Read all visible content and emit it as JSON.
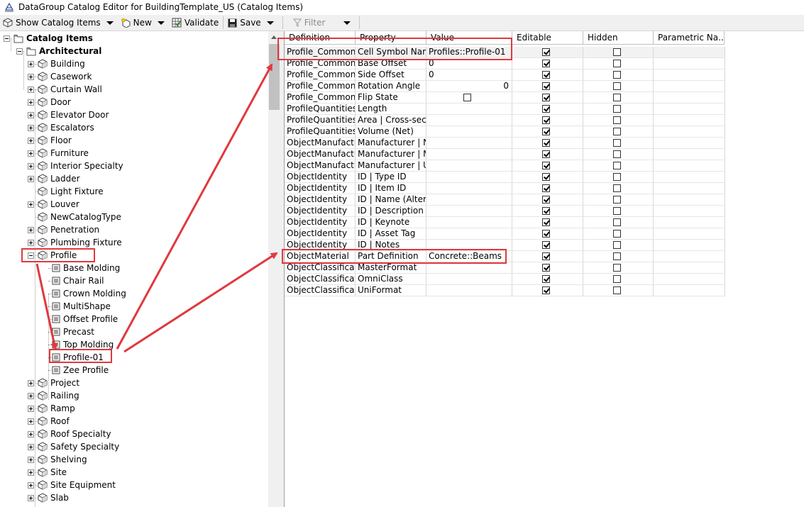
{
  "window": {
    "title": "DataGroup Catalog Editor for BuildingTemplate_US (Catalog Items)"
  },
  "toolbar": {
    "show_catalog_label": "Show Catalog Items",
    "new_label": "New",
    "validate_label": "Validate",
    "save_label": "Save",
    "filter_placeholder": "Filter"
  },
  "tree": {
    "nodes": [
      {
        "label": "Catalog Items",
        "level": 0,
        "expander": "minus",
        "icon": "folder-icon",
        "bold": true
      },
      {
        "label": "Architectural",
        "level": 1,
        "expander": "minus",
        "icon": "folder-icon",
        "bold": true
      },
      {
        "label": "Building",
        "level": 2,
        "expander": "plus",
        "icon": "cube-icon"
      },
      {
        "label": "Casework",
        "level": 2,
        "expander": "plus",
        "icon": "cube-icon"
      },
      {
        "label": "Curtain Wall",
        "level": 2,
        "expander": "plus",
        "icon": "cube-icon"
      },
      {
        "label": "Door",
        "level": 2,
        "expander": "plus",
        "icon": "cube-icon"
      },
      {
        "label": "Elevator Door",
        "level": 2,
        "expander": "plus",
        "icon": "cube-icon"
      },
      {
        "label": "Escalators",
        "level": 2,
        "expander": "plus",
        "icon": "cube-icon"
      },
      {
        "label": "Floor",
        "level": 2,
        "expander": "plus",
        "icon": "cube-icon"
      },
      {
        "label": "Furniture",
        "level": 2,
        "expander": "plus",
        "icon": "cube-icon"
      },
      {
        "label": "Interior Specialty",
        "level": 2,
        "expander": "plus",
        "icon": "cube-icon"
      },
      {
        "label": "Ladder",
        "level": 2,
        "expander": "plus",
        "icon": "cube-icon"
      },
      {
        "label": "Light Fixture",
        "level": 2,
        "expander": "none",
        "icon": "cube-icon"
      },
      {
        "label": "Louver",
        "level": 2,
        "expander": "plus",
        "icon": "cube-icon"
      },
      {
        "label": "NewCatalogType",
        "level": 2,
        "expander": "none",
        "icon": "cube-icon"
      },
      {
        "label": "Penetration",
        "level": 2,
        "expander": "plus",
        "icon": "cube-icon"
      },
      {
        "label": "Plumbing Fixture",
        "level": 2,
        "expander": "plus",
        "icon": "cube-icon"
      },
      {
        "label": "Profile",
        "level": 2,
        "expander": "minus",
        "icon": "cube-icon"
      },
      {
        "label": "Base Molding",
        "level": 3,
        "expander": "none",
        "icon": "item-icon"
      },
      {
        "label": "Chair Rail",
        "level": 3,
        "expander": "none",
        "icon": "item-icon"
      },
      {
        "label": "Crown Molding",
        "level": 3,
        "expander": "none",
        "icon": "item-icon"
      },
      {
        "label": "MultiShape",
        "level": 3,
        "expander": "none",
        "icon": "item-icon"
      },
      {
        "label": "Offset Profile",
        "level": 3,
        "expander": "none",
        "icon": "item-icon"
      },
      {
        "label": "Precast",
        "level": 3,
        "expander": "none",
        "icon": "item-icon"
      },
      {
        "label": "Top Molding",
        "level": 3,
        "expander": "none",
        "icon": "item-icon"
      },
      {
        "label": "Profile-01",
        "level": 3,
        "expander": "none",
        "icon": "item-icon"
      },
      {
        "label": "Zee Profile",
        "level": 3,
        "expander": "none",
        "icon": "item-icon"
      },
      {
        "label": "Project",
        "level": 2,
        "expander": "plus",
        "icon": "cube-icon"
      },
      {
        "label": "Railing",
        "level": 2,
        "expander": "plus",
        "icon": "cube-icon"
      },
      {
        "label": "Ramp",
        "level": 2,
        "expander": "plus",
        "icon": "cube-icon"
      },
      {
        "label": "Roof",
        "level": 2,
        "expander": "plus",
        "icon": "cube-icon"
      },
      {
        "label": "Roof Specialty",
        "level": 2,
        "expander": "plus",
        "icon": "cube-icon"
      },
      {
        "label": "Safety Specialty",
        "level": 2,
        "expander": "plus",
        "icon": "cube-icon"
      },
      {
        "label": "Shelving",
        "level": 2,
        "expander": "plus",
        "icon": "cube-icon"
      },
      {
        "label": "Site",
        "level": 2,
        "expander": "plus",
        "icon": "cube-icon"
      },
      {
        "label": "Site Equipment",
        "level": 2,
        "expander": "plus",
        "icon": "cube-icon"
      },
      {
        "label": "Slab",
        "level": 2,
        "expander": "plus",
        "icon": "cube-icon"
      }
    ]
  },
  "grid": {
    "columns": [
      "Definition",
      "Property",
      "Value",
      "Editable",
      "Hidden",
      "Parametric Na..."
    ],
    "rows": [
      {
        "definition": "Profile_Common",
        "property": "Cell Symbol Name",
        "value": "Profiles::Profile-01",
        "value_kind": "text",
        "editable": true,
        "hidden": false
      },
      {
        "definition": "Profile_Common",
        "property": "Base Offset",
        "value": "0",
        "value_kind": "text",
        "editable": true,
        "hidden": false
      },
      {
        "definition": "Profile_Common",
        "property": "Side Offset",
        "value": "0",
        "value_kind": "text",
        "editable": true,
        "hidden": false
      },
      {
        "definition": "Profile_Common",
        "property": "Rotation Angle",
        "value": "0",
        "value_kind": "right",
        "editable": true,
        "hidden": false
      },
      {
        "definition": "Profile_Common",
        "property": "Flip State",
        "value": "",
        "value_kind": "checkbox",
        "editable": true,
        "hidden": false
      },
      {
        "definition": "ProfileQuantities",
        "property": "Length",
        "value": "",
        "value_kind": "text",
        "editable": true,
        "hidden": false
      },
      {
        "definition": "ProfileQuantities",
        "property": "Area | Cross-section",
        "value": "",
        "value_kind": "text",
        "editable": true,
        "hidden": false
      },
      {
        "definition": "ProfileQuantities",
        "property": "Volume (Net)",
        "value": "",
        "value_kind": "text",
        "editable": true,
        "hidden": false
      },
      {
        "definition": "ObjectManufacturer",
        "property": "Manufacturer | Name",
        "value": "",
        "value_kind": "text",
        "editable": true,
        "hidden": false
      },
      {
        "definition": "ObjectManufacturer",
        "property": "Manufacturer | Model",
        "value": "",
        "value_kind": "text",
        "editable": true,
        "hidden": false
      },
      {
        "definition": "ObjectManufacturer",
        "property": "Manufacturer | URL",
        "value": "",
        "value_kind": "text",
        "editable": true,
        "hidden": false
      },
      {
        "definition": "ObjectIdentity",
        "property": "ID | Type ID",
        "value": "",
        "value_kind": "text",
        "editable": true,
        "hidden": false
      },
      {
        "definition": "ObjectIdentity",
        "property": "ID | Item ID",
        "value": "",
        "value_kind": "text",
        "editable": true,
        "hidden": false
      },
      {
        "definition": "ObjectIdentity",
        "property": "ID | Name (Alternate)",
        "value": "",
        "value_kind": "text",
        "editable": true,
        "hidden": false
      },
      {
        "definition": "ObjectIdentity",
        "property": "ID | Description",
        "value": "",
        "value_kind": "text",
        "editable": true,
        "hidden": false
      },
      {
        "definition": "ObjectIdentity",
        "property": "ID | Keynote",
        "value": "",
        "value_kind": "text",
        "editable": true,
        "hidden": false
      },
      {
        "definition": "ObjectIdentity",
        "property": "ID | Asset Tag",
        "value": "",
        "value_kind": "text",
        "editable": true,
        "hidden": false
      },
      {
        "definition": "ObjectIdentity",
        "property": "ID | Notes",
        "value": "",
        "value_kind": "text",
        "editable": true,
        "hidden": false
      },
      {
        "definition": "ObjectMaterial",
        "property": "Part Definition",
        "value": "Concrete::Beams",
        "value_kind": "text",
        "editable": true,
        "hidden": false
      },
      {
        "definition": "ObjectClassification",
        "property": "MasterFormat",
        "value": "",
        "value_kind": "text",
        "editable": true,
        "hidden": false
      },
      {
        "definition": "ObjectClassification",
        "property": "OmniClass",
        "value": "",
        "value_kind": "text",
        "editable": true,
        "hidden": false
      },
      {
        "definition": "ObjectClassification",
        "property": "UniFormat",
        "value": "",
        "value_kind": "text",
        "editable": true,
        "hidden": false
      }
    ]
  },
  "colors": {
    "annotation": "#e0393e",
    "toolbar_bg": "#f0f0f0"
  }
}
